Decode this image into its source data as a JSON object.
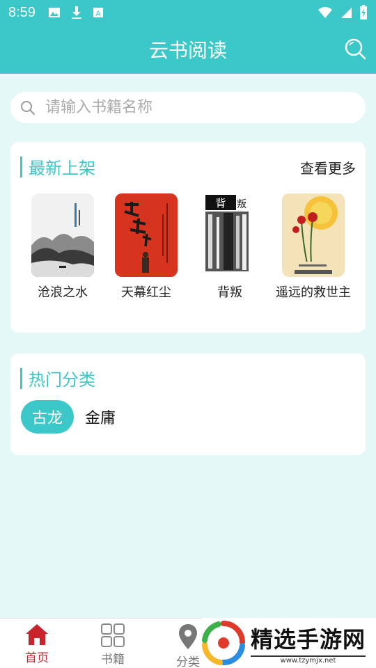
{
  "status_bar": {
    "time": "8:59"
  },
  "app_bar": {
    "title": "云书阅读"
  },
  "search": {
    "placeholder": "请输入书籍名称"
  },
  "latest": {
    "title": "最新上架",
    "more_label": "查看更多",
    "books": [
      {
        "name": "沧浪之水"
      },
      {
        "name": "天幕红尘"
      },
      {
        "name": "背叛"
      },
      {
        "name": "遥远的救世主"
      }
    ]
  },
  "categories": {
    "title": "热门分类",
    "items": [
      {
        "label": "古龙",
        "selected": true
      },
      {
        "label": "金庸",
        "selected": false
      }
    ]
  },
  "bottom_nav": {
    "items": [
      {
        "label": "首页",
        "icon": "home-icon",
        "active": true
      },
      {
        "label": "书籍",
        "icon": "grid-icon",
        "active": false
      },
      {
        "label": "分类",
        "icon": "location-pin-icon",
        "active": false
      }
    ]
  },
  "watermark": {
    "title": "精选手游网",
    "url": "www.tzymjx.net"
  },
  "colors": {
    "accent": "#3cc7c9",
    "background": "#e4f8f8",
    "nav_active": "#c8242b"
  }
}
